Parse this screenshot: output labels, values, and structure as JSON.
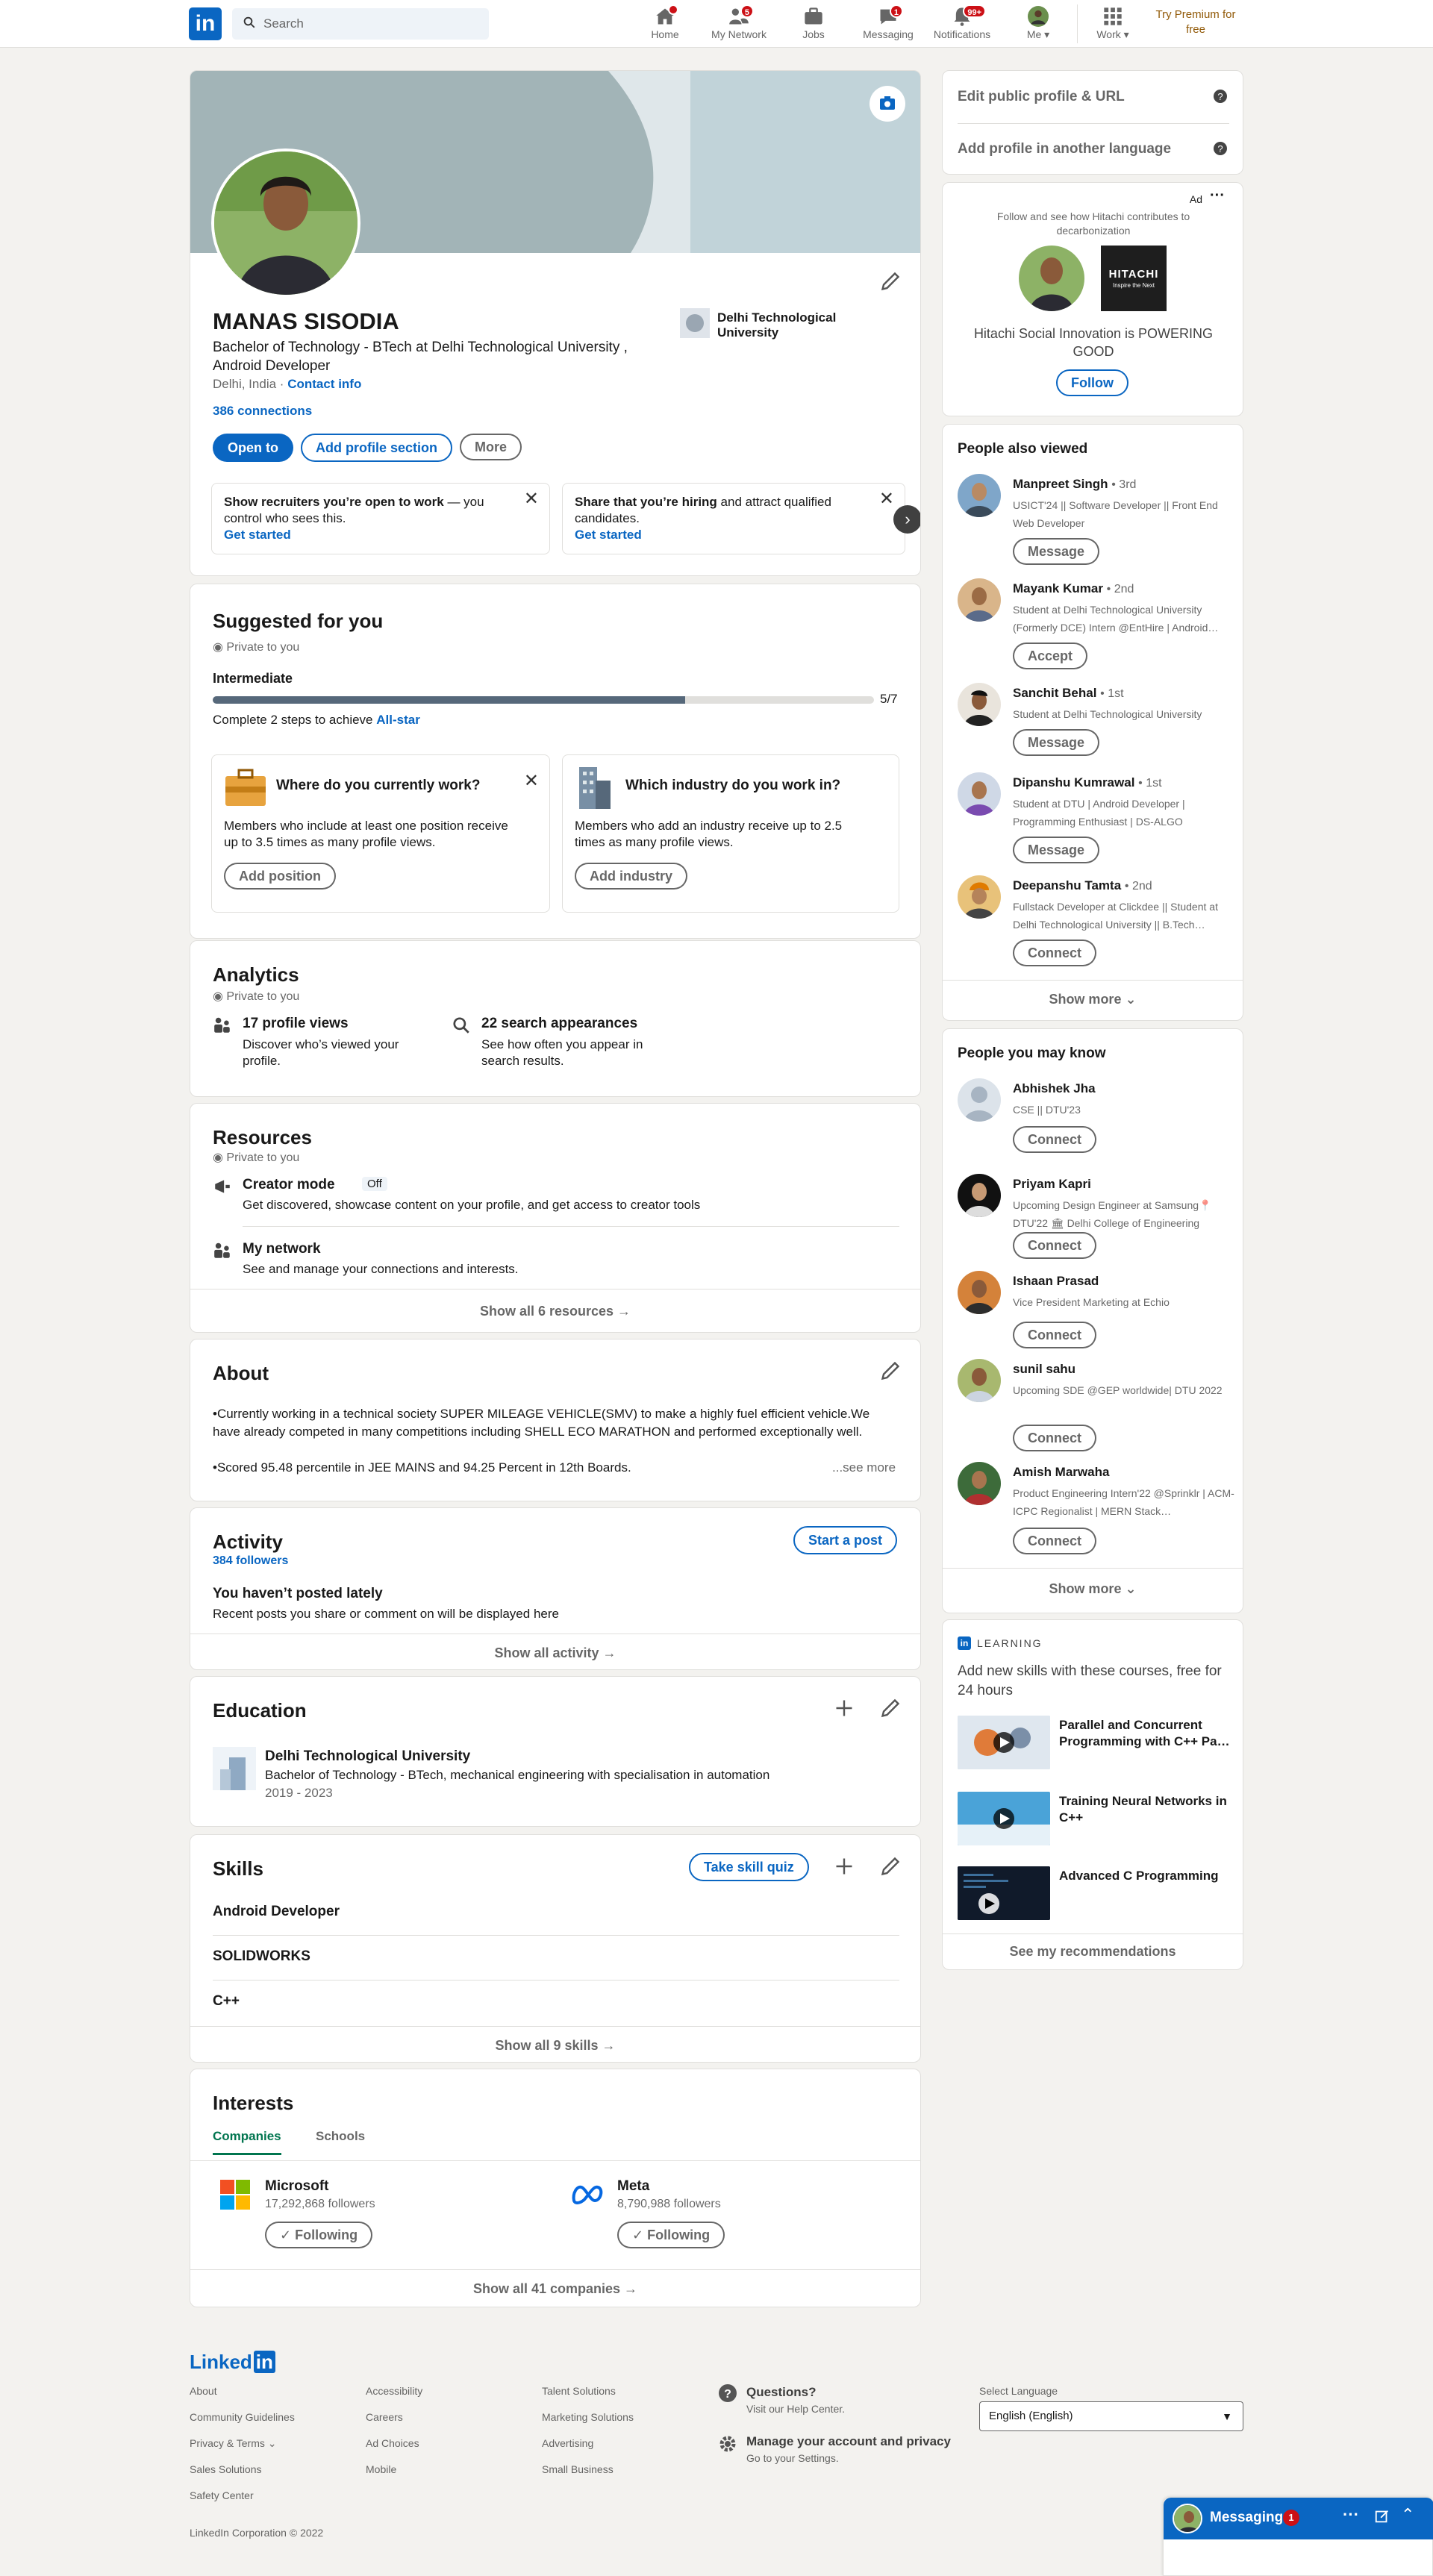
{
  "nav": {
    "logo": "in",
    "search_placeholder": "Search",
    "items": [
      {
        "label": "Home",
        "badge": ""
      },
      {
        "label": "My Network",
        "badge": "5"
      },
      {
        "label": "Jobs",
        "badge": ""
      },
      {
        "label": "Messaging",
        "badge": "1"
      },
      {
        "label": "Notifications",
        "badge": "99+"
      },
      {
        "label": "Me",
        "badge": ""
      },
      {
        "label": "Work",
        "badge": ""
      }
    ],
    "premium": "Try Premium for free"
  },
  "profile": {
    "name": "MANAS SISODIA",
    "headline": "Bachelor of Technology - BTech at Delhi Technological University , Android Developer",
    "location": "Delhi, India",
    "contact": "Contact info",
    "connections": "386 connections",
    "school": "Delhi Technological University",
    "btn_open": "Open to",
    "btn_add": "Add profile section",
    "btn_more": "More",
    "promo1_bold": "Show recruiters you’re open to work",
    "promo1_rest": " — you control who sees this.",
    "promo1_link": "Get started",
    "promo2_a": "Share that you’re hiring",
    "promo2_b": " and attract qualified candidates.",
    "promo2_link": "Get started"
  },
  "suggested": {
    "title": "Suggested for you",
    "private": "Private to you",
    "level": "Intermediate",
    "progress_value": 5,
    "progress_max": 7,
    "progress_label": "5/7",
    "complete_text": "Complete 2 steps to achieve ",
    "allstar": "All-star",
    "card1_title": "Where do you currently work?",
    "card1_body": "Members who include at least one position receive up to 3.5 times as many profile views.",
    "card1_btn": "Add position",
    "card2_title": "Which industry do you work in?",
    "card2_body": "Members who add an industry receive up to 2.5 times as many profile views.",
    "card2_btn": "Add industry"
  },
  "analytics": {
    "title": "Analytics",
    "private": "Private to you",
    "views_title": "17 profile views",
    "views_sub": "Discover who’s viewed your profile.",
    "search_title": "22 search appearances",
    "search_sub": "See how often you appear in search results."
  },
  "resources": {
    "title": "Resources",
    "private": "Private to you",
    "creator_title": "Creator mode",
    "creator_badge": "Off",
    "creator_sub": "Get discovered, showcase content on your profile, and get access to creator tools",
    "network_title": "My network",
    "network_sub": "See and manage your connections and interests.",
    "show_all": "Show all 6 resources →"
  },
  "about": {
    "title": "About",
    "para1": "•Currently working in a technical society SUPER MILEAGE VEHICLE(SMV) to make a highly fuel efficient vehicle.We have already competed in many competitions including SHELL ECO MARATHON and performed exceptionally well.",
    "para2": "•Scored 95.48 percentile in JEE MAINS and 94.25 Percent in 12th Boards.",
    "see_more": "...see more"
  },
  "activity": {
    "title": "Activity",
    "followers": "384 followers",
    "start_post": "Start a post",
    "empty_title": "You haven’t posted lately",
    "empty_sub": "Recent posts you share or comment on will be displayed here",
    "show_all": "Show all activity →"
  },
  "education": {
    "title": "Education",
    "school": "Delhi Technological University",
    "degree": "Bachelor of Technology - BTech, mechanical engineering with specialisation in automation",
    "years": "2019 - 2023"
  },
  "skills": {
    "title": "Skills",
    "quiz": "Take skill quiz",
    "items": [
      "Android Developer",
      "SOLIDWORKS",
      "C++"
    ],
    "show_all": "Show all 9 skills →"
  },
  "interests": {
    "title": "Interests",
    "tab1": "Companies",
    "tab2": "Schools",
    "c1_name": "Microsoft",
    "c1_followers": "17,292,868 followers",
    "c2_name": "Meta",
    "c2_followers": "8,790,988 followers",
    "following": "✓ Following",
    "show_all": "Show all 41 companies →"
  },
  "sidebar": {
    "edit_url": "Edit public profile & URL",
    "add_lang": "Add profile in another language",
    "ad_label": "Ad",
    "ad_text": "Follow and see how Hitachi contributes to decarbonization",
    "ad_brand": "HITACHI",
    "ad_tagline": "Inspire the Next",
    "ad_headline": "Hitachi Social Innovation is POWERING GOOD",
    "ad_follow": "Follow",
    "pav_title": "People also viewed",
    "pav": [
      {
        "name": "Manpreet Singh",
        "degree": "• 3rd",
        "sub": "USICT'24 || Software Developer || Front End Web Developer",
        "btn": "Message"
      },
      {
        "name": "Mayank Kumar",
        "degree": "• 2nd",
        "sub": "Student at Delhi Technological University (Formerly DCE) Intern @EntHire | Android…",
        "btn": "Accept"
      },
      {
        "name": "Sanchit Behal",
        "degree": "• 1st",
        "sub": "Student at Delhi Technological University",
        "btn": "Message"
      },
      {
        "name": "Dipanshu Kumrawal",
        "degree": "• 1st",
        "sub": "Student at DTU | Android Developer | Programming Enthusiast | DS-ALGO",
        "btn": "Message"
      },
      {
        "name": "Deepanshu Tamta",
        "degree": "• 2nd",
        "sub": "Fullstack Developer at Clickdee || Student at Delhi Technological University || B.Tech…",
        "btn": "Connect"
      }
    ],
    "show_more": "Show more",
    "pymk_title": "People you may know",
    "pymk": [
      {
        "name": "Abhishek Jha",
        "sub": "CSE || DTU'23",
        "btn": "Connect"
      },
      {
        "name": "Priyam Kapri",
        "sub": "Upcoming Design Engineer at Samsung📍DTU'22 🏛 Delhi College of Engineering",
        "btn": "Connect"
      },
      {
        "name": "Ishaan Prasad",
        "sub": "Vice President Marketing at Echio",
        "btn": "Connect"
      },
      {
        "name": "sunil sahu",
        "sub": "Upcoming SDE @GEP worldwide| DTU 2022",
        "btn": "Connect"
      },
      {
        "name": "Amish Marwaha",
        "sub": "Product Engineering Intern'22 @Sprinklr | ACM-ICPC Regionalist | MERN Stack…",
        "btn": "Connect"
      }
    ],
    "learning_label": "LEARNING",
    "learning_head": "Add new skills with these courses, free for 24 hours",
    "courses": [
      "Parallel and Concurrent Programming with C++ Pa…",
      "Training Neural Networks in C++",
      "Advanced C Programming"
    ],
    "see_recs": "See my recommendations"
  },
  "footer": {
    "logo_a": "Linked",
    "logo_b": "in",
    "col1": [
      "About",
      "Community Guidelines",
      "Privacy & Terms",
      "Sales Solutions",
      "Safety Center"
    ],
    "col2": [
      "Accessibility",
      "Careers",
      "Ad Choices",
      "Mobile"
    ],
    "col3": [
      "Talent Solutions",
      "Marketing Solutions",
      "Advertising",
      "Small Business"
    ],
    "q_title": "Questions?",
    "q_sub": "Visit our Help Center.",
    "m_title": "Manage your account and privacy",
    "m_sub": "Go to your Settings.",
    "lang_label": "Select Language",
    "lang_value": "English (English)",
    "copyright": "LinkedIn Corporation © 2022"
  },
  "messaging": {
    "label": "Messaging",
    "badge": "1"
  },
  "colors": {
    "brand": "#0a66c2",
    "accent_green": "#01754f",
    "badge_red": "#cc1016"
  }
}
